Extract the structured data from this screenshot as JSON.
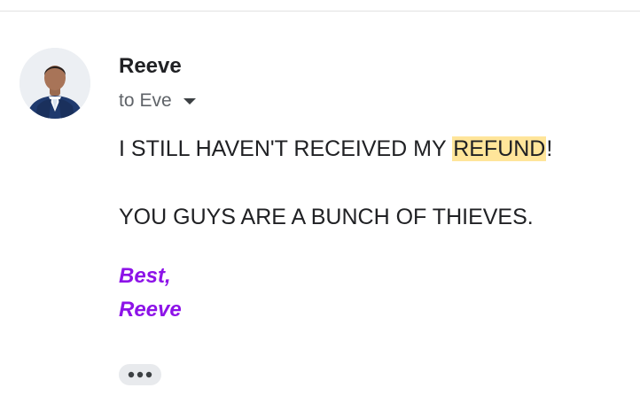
{
  "email": {
    "sender": {
      "name": "Reeve",
      "avatar_icon": "profile-photo"
    },
    "recipient": {
      "prefix": "to",
      "name": "Eve",
      "expand_icon": "chevron-down-icon"
    },
    "body": {
      "line1_before": "I STILL HAVEN'T RECEIVED MY",
      "line1_highlight": "REFUND",
      "line1_after": "!",
      "line2": "YOU GUYS ARE A BUNCH OF THIEVES."
    },
    "signature": {
      "closing": "Best,",
      "name": "Reeve"
    },
    "more_button_icon": "more-horiz-icon"
  },
  "colors": {
    "highlight": "#ffe59a",
    "signature": "#8d13e8",
    "text": "#202124",
    "secondary_text": "#5f6368"
  }
}
